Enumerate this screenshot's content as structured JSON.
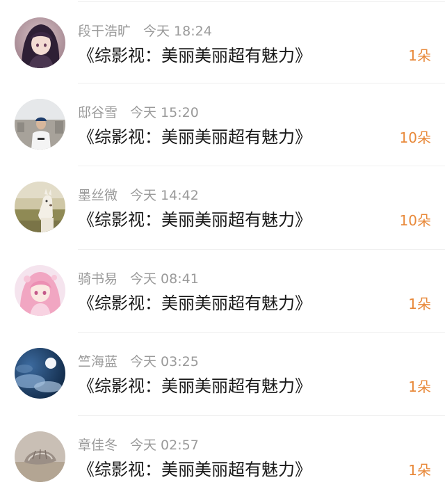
{
  "items": [
    {
      "name": "段干浩旷",
      "time": "今天 18:24",
      "title": "《综影视：美丽美丽超有魅力》",
      "gift": "1朵",
      "avatar_icon": "anime-girl-dark-hair-avatar-icon"
    },
    {
      "name": "邸谷雪",
      "time": "今天 15:20",
      "title": "《综影视：美丽美丽超有魅力》",
      "gift": "10朵",
      "avatar_icon": "boy-photo-avatar-icon"
    },
    {
      "name": "墨丝微",
      "time": "今天 14:42",
      "title": "《综影视：美丽美丽超有魅力》",
      "gift": "10朵",
      "avatar_icon": "alpaca-avatar-icon"
    },
    {
      "name": "骑书易",
      "time": "今天 08:41",
      "title": "《综影视：美丽美丽超有魅力》",
      "gift": "1朵",
      "avatar_icon": "anime-girl-pink-hair-avatar-icon"
    },
    {
      "name": "竺海蓝",
      "time": "今天 03:25",
      "title": "《综影视：美丽美丽超有魅力》",
      "gift": "1朵",
      "avatar_icon": "moon-night-sky-avatar-icon"
    },
    {
      "name": "章佳冬",
      "time": "今天 02:57",
      "title": "《综影视：美丽美丽超有魅力》",
      "gift": "1朵",
      "avatar_icon": "seashell-avatar-icon"
    }
  ],
  "colors": {
    "gift": "#e8893a",
    "meta": "#9a9a9a",
    "title": "#1a1a1a"
  }
}
